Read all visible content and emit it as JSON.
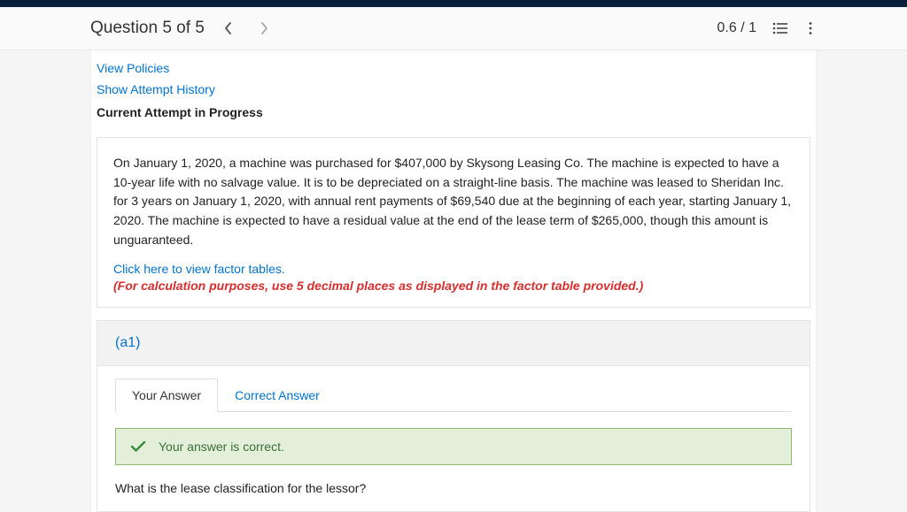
{
  "header": {
    "question_title": "Question 5 of 5",
    "score": "0.6 / 1"
  },
  "links": {
    "view_policies": "View Policies",
    "show_history": "Show Attempt History",
    "attempt_label": "Current Attempt in Progress"
  },
  "question": {
    "body": "On January 1, 2020, a machine was purchased for $407,000 by Skysong Leasing Co. The machine is expected to have a 10-year life with no salvage value. It is to be depreciated on a straight-line basis. The machine was leased to Sheridan Inc. for 3 years on January 1, 2020, with annual rent payments of $69,540 due at the beginning of each year, starting January 1, 2020. The machine is expected to have a residual value at the end of the lease term of $265,000, though this amount is unguaranteed.",
    "factor_link": "Click here to view factor tables.",
    "calc_note": "(For calculation purposes, use 5 decimal places as displayed in the factor table provided.)"
  },
  "part": {
    "label": "(a1)",
    "tabs": {
      "your_answer": "Your Answer",
      "correct_answer": "Correct Answer"
    },
    "banner_text": "Your answer is correct.",
    "prompt": "What is the lease classification for the lessor?"
  }
}
